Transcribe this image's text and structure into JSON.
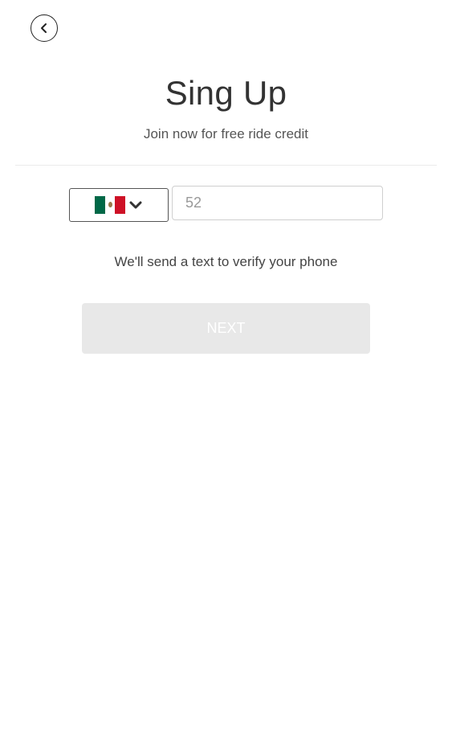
{
  "header": {
    "back_icon": "chevron-left-icon",
    "title": "Sing Up",
    "subtitle": "Join now for free ride credit"
  },
  "phone_form": {
    "country": {
      "selected_flag": "mexico-flag-icon",
      "flag_colors": [
        "#006847",
        "#ffffff",
        "#ce1126"
      ],
      "dropdown_icon": "chevron-down-icon"
    },
    "phone_input": {
      "value": "52",
      "placeholder": ""
    },
    "hint": "We'll send a text to verify your phone"
  },
  "actions": {
    "next_label": "NEXT",
    "next_disabled_color": "#e8e8e8"
  }
}
